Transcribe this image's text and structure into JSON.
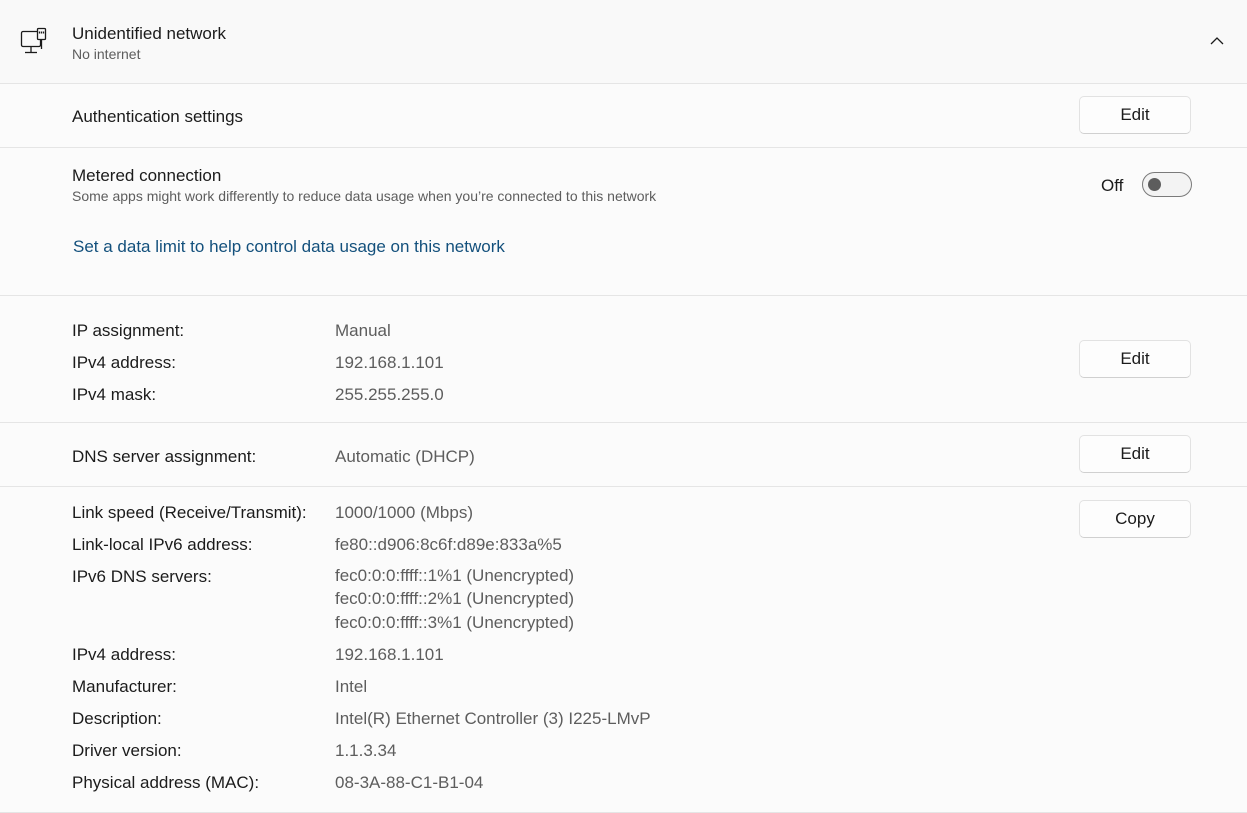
{
  "header": {
    "title": "Unidentified network",
    "status": "No internet",
    "icon": "wired-network-icon",
    "expand_icon": "chevron-up-icon"
  },
  "authentication": {
    "label": "Authentication settings",
    "edit_label": "Edit"
  },
  "metered": {
    "label": "Metered connection",
    "description": "Some apps might work differently to reduce data usage when you’re connected to this network",
    "toggle_state": "Off",
    "toggle_on": false,
    "data_limit_link": "Set a data limit to help control data usage on this network"
  },
  "ip": {
    "rows": [
      {
        "label": "IP assignment:",
        "value": "Manual"
      },
      {
        "label": "IPv4 address:",
        "value": "192.168.1.101"
      },
      {
        "label": "IPv4 mask:",
        "value": "255.255.255.0"
      }
    ],
    "edit_label": "Edit"
  },
  "dns": {
    "label": "DNS server assignment:",
    "value": "Automatic (DHCP)",
    "edit_label": "Edit"
  },
  "properties": {
    "copy_label": "Copy",
    "link_speed": {
      "label": "Link speed (Receive/Transmit):",
      "value": "1000/1000 (Mbps)"
    },
    "link_local_ipv6": {
      "label": "Link-local IPv6 address:",
      "value": "fe80::d906:8c6f:d89e:833a%5"
    },
    "ipv6_dns": {
      "label": "IPv6 DNS servers:",
      "values": [
        "fec0:0:0:ffff::1%1 (Unencrypted)",
        "fec0:0:0:ffff::2%1 (Unencrypted)",
        "fec0:0:0:ffff::3%1 (Unencrypted)"
      ]
    },
    "ipv4_address": {
      "label": "IPv4 address:",
      "value": "192.168.1.101"
    },
    "manufacturer": {
      "label": "Manufacturer:",
      "value": "Intel"
    },
    "description": {
      "label": "Description:",
      "value": "Intel(R) Ethernet Controller (3) I225-LMvP"
    },
    "driver_version": {
      "label": "Driver version:",
      "value": "1.1.3.34"
    },
    "mac": {
      "label": "Physical address (MAC):",
      "value": "08-3A-88-C1-B1-04"
    }
  }
}
